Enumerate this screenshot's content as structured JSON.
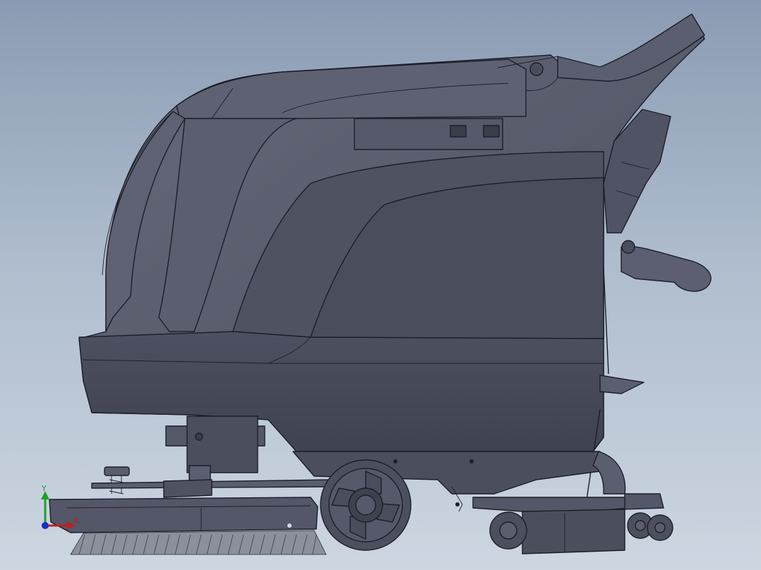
{
  "triad": {
    "y_label": "Y",
    "x_label": "X",
    "y_color": "#1fa02a",
    "x_color": "#c0201a",
    "z_color": "#1a2ec0"
  },
  "colors": {
    "body": "#545868",
    "body_light": "#646878",
    "body_dark": "#444756",
    "edge": "#1c1f29"
  }
}
